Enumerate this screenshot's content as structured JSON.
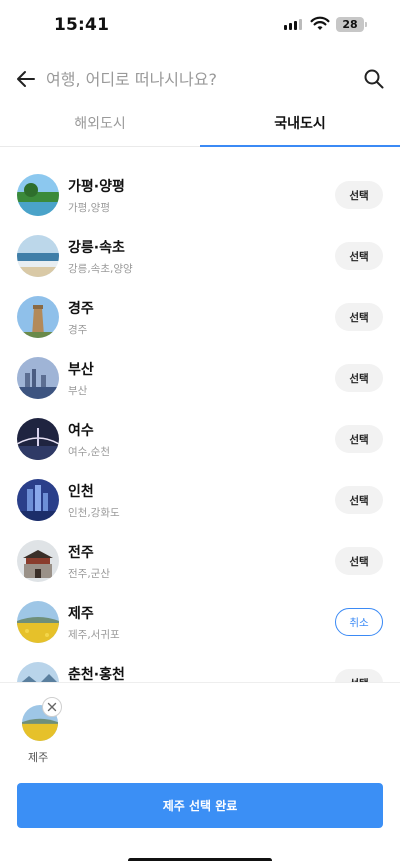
{
  "status_bar": {
    "time": "15:41",
    "battery": "28"
  },
  "search": {
    "placeholder": "여행, 어디로 떠나시나요?"
  },
  "tabs": [
    {
      "label": "해외도시",
      "active": false
    },
    {
      "label": "국내도시",
      "active": true
    }
  ],
  "cities": [
    {
      "name": "가평·양평",
      "sub": "가평,양평",
      "action": "선택",
      "selected": false
    },
    {
      "name": "강릉·속초",
      "sub": "강릉,속초,양양",
      "action": "선택",
      "selected": false
    },
    {
      "name": "경주",
      "sub": "경주",
      "action": "선택",
      "selected": false
    },
    {
      "name": "부산",
      "sub": "부산",
      "action": "선택",
      "selected": false
    },
    {
      "name": "여수",
      "sub": "여수,순천",
      "action": "선택",
      "selected": false
    },
    {
      "name": "인천",
      "sub": "인천,강화도",
      "action": "선택",
      "selected": false
    },
    {
      "name": "전주",
      "sub": "전주,군산",
      "action": "선택",
      "selected": false
    },
    {
      "name": "제주",
      "sub": "제주,서귀포",
      "action": "취소",
      "selected": true
    },
    {
      "name": "춘천·홍천",
      "sub": "",
      "action": "선택",
      "selected": false
    }
  ],
  "selection": {
    "chips": [
      {
        "label": "제주"
      }
    ],
    "confirm_label": "제주 선택 완료"
  },
  "colors": {
    "accent": "#3b8af5",
    "button_bg": "#f2f2f2",
    "muted_text": "#9a9a9a"
  },
  "icons": [
    "back-arrow-icon",
    "search-icon",
    "close-icon",
    "wifi-icon",
    "battery-icon",
    "signal-icon"
  ]
}
